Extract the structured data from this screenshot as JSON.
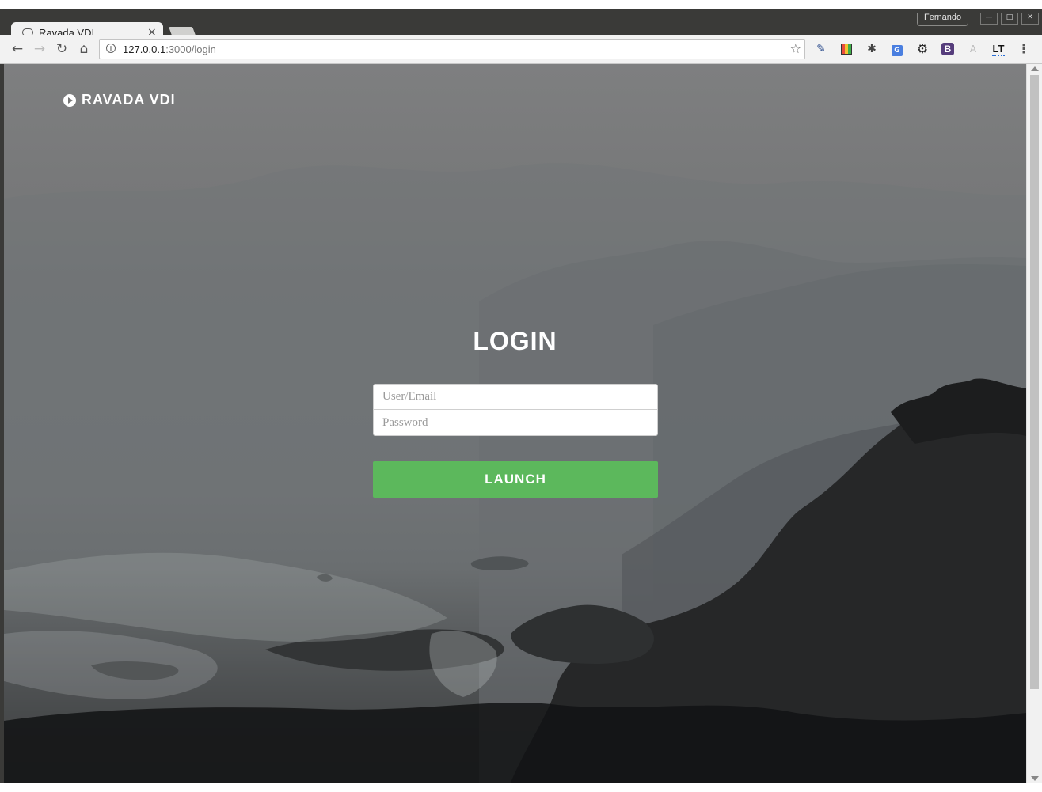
{
  "browser": {
    "profile_name": "Fernando",
    "tab": {
      "title": "Ravada VDI",
      "close": "×"
    },
    "address": {
      "host": "127.0.0.1",
      "path": ":3000/login"
    },
    "extensions": [
      "eyedropper-icon",
      "tag-assistant-icon",
      "bug-icon",
      "translate-icon",
      "gear-icon",
      "bootstrap-icon",
      "angular-icon",
      "languagetool-icon"
    ],
    "ext_labels": {
      "translate": "G",
      "bootstrap": "B",
      "languagetool": "LT",
      "angular": "A"
    }
  },
  "page": {
    "brand": "RAVADA VDI",
    "login_title": "LOGIN",
    "user_placeholder": "User/Email",
    "password_placeholder": "Password",
    "launch_label": "LAUNCH",
    "accent_color": "#5cb85c"
  }
}
